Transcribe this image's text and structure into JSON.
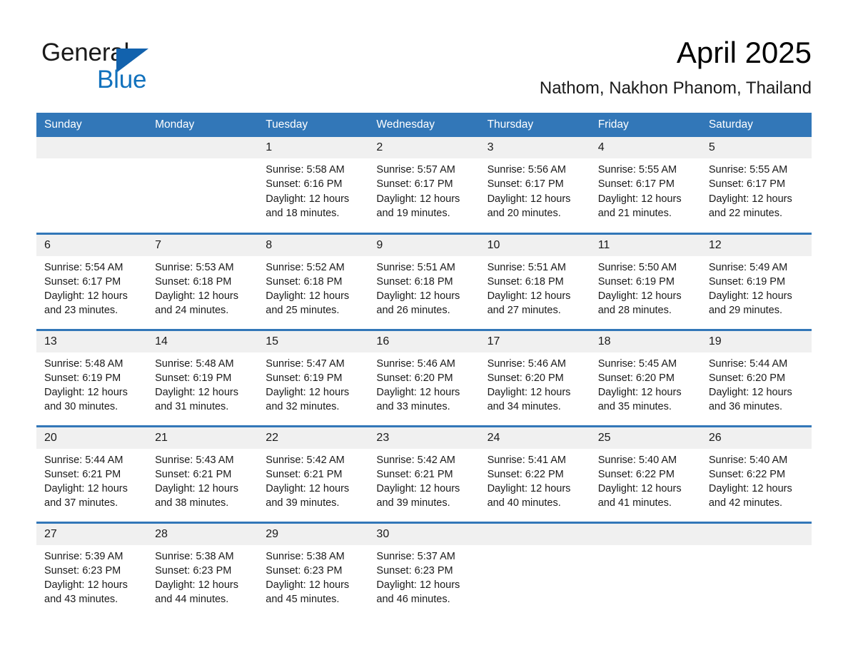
{
  "brand": {
    "logo_text_top": "General",
    "logo_text_bottom": "Blue",
    "accent_blue": "#1272bd"
  },
  "header": {
    "title": "April 2025",
    "location": "Nathom, Nakhon Phanom, Thailand"
  },
  "theme": {
    "header_blue": "#3277b8",
    "daynum_band": "#f0f0f0",
    "text": "#1a1a1a"
  },
  "weekdays": [
    "Sunday",
    "Monday",
    "Tuesday",
    "Wednesday",
    "Thursday",
    "Friday",
    "Saturday"
  ],
  "weeks": [
    [
      {
        "day": "",
        "empty": true
      },
      {
        "day": "",
        "empty": true
      },
      {
        "day": "1",
        "sunrise": "Sunrise: 5:58 AM",
        "sunset": "Sunset: 6:16 PM",
        "daylight": "Daylight: 12 hours and 18 minutes."
      },
      {
        "day": "2",
        "sunrise": "Sunrise: 5:57 AM",
        "sunset": "Sunset: 6:17 PM",
        "daylight": "Daylight: 12 hours and 19 minutes."
      },
      {
        "day": "3",
        "sunrise": "Sunrise: 5:56 AM",
        "sunset": "Sunset: 6:17 PM",
        "daylight": "Daylight: 12 hours and 20 minutes."
      },
      {
        "day": "4",
        "sunrise": "Sunrise: 5:55 AM",
        "sunset": "Sunset: 6:17 PM",
        "daylight": "Daylight: 12 hours and 21 minutes."
      },
      {
        "day": "5",
        "sunrise": "Sunrise: 5:55 AM",
        "sunset": "Sunset: 6:17 PM",
        "daylight": "Daylight: 12 hours and 22 minutes."
      }
    ],
    [
      {
        "day": "6",
        "sunrise": "Sunrise: 5:54 AM",
        "sunset": "Sunset: 6:17 PM",
        "daylight": "Daylight: 12 hours and 23 minutes."
      },
      {
        "day": "7",
        "sunrise": "Sunrise: 5:53 AM",
        "sunset": "Sunset: 6:18 PM",
        "daylight": "Daylight: 12 hours and 24 minutes."
      },
      {
        "day": "8",
        "sunrise": "Sunrise: 5:52 AM",
        "sunset": "Sunset: 6:18 PM",
        "daylight": "Daylight: 12 hours and 25 minutes."
      },
      {
        "day": "9",
        "sunrise": "Sunrise: 5:51 AM",
        "sunset": "Sunset: 6:18 PM",
        "daylight": "Daylight: 12 hours and 26 minutes."
      },
      {
        "day": "10",
        "sunrise": "Sunrise: 5:51 AM",
        "sunset": "Sunset: 6:18 PM",
        "daylight": "Daylight: 12 hours and 27 minutes."
      },
      {
        "day": "11",
        "sunrise": "Sunrise: 5:50 AM",
        "sunset": "Sunset: 6:19 PM",
        "daylight": "Daylight: 12 hours and 28 minutes."
      },
      {
        "day": "12",
        "sunrise": "Sunrise: 5:49 AM",
        "sunset": "Sunset: 6:19 PM",
        "daylight": "Daylight: 12 hours and 29 minutes."
      }
    ],
    [
      {
        "day": "13",
        "sunrise": "Sunrise: 5:48 AM",
        "sunset": "Sunset: 6:19 PM",
        "daylight": "Daylight: 12 hours and 30 minutes."
      },
      {
        "day": "14",
        "sunrise": "Sunrise: 5:48 AM",
        "sunset": "Sunset: 6:19 PM",
        "daylight": "Daylight: 12 hours and 31 minutes."
      },
      {
        "day": "15",
        "sunrise": "Sunrise: 5:47 AM",
        "sunset": "Sunset: 6:19 PM",
        "daylight": "Daylight: 12 hours and 32 minutes."
      },
      {
        "day": "16",
        "sunrise": "Sunrise: 5:46 AM",
        "sunset": "Sunset: 6:20 PM",
        "daylight": "Daylight: 12 hours and 33 minutes."
      },
      {
        "day": "17",
        "sunrise": "Sunrise: 5:46 AM",
        "sunset": "Sunset: 6:20 PM",
        "daylight": "Daylight: 12 hours and 34 minutes."
      },
      {
        "day": "18",
        "sunrise": "Sunrise: 5:45 AM",
        "sunset": "Sunset: 6:20 PM",
        "daylight": "Daylight: 12 hours and 35 minutes."
      },
      {
        "day": "19",
        "sunrise": "Sunrise: 5:44 AM",
        "sunset": "Sunset: 6:20 PM",
        "daylight": "Daylight: 12 hours and 36 minutes."
      }
    ],
    [
      {
        "day": "20",
        "sunrise": "Sunrise: 5:44 AM",
        "sunset": "Sunset: 6:21 PM",
        "daylight": "Daylight: 12 hours and 37 minutes."
      },
      {
        "day": "21",
        "sunrise": "Sunrise: 5:43 AM",
        "sunset": "Sunset: 6:21 PM",
        "daylight": "Daylight: 12 hours and 38 minutes."
      },
      {
        "day": "22",
        "sunrise": "Sunrise: 5:42 AM",
        "sunset": "Sunset: 6:21 PM",
        "daylight": "Daylight: 12 hours and 39 minutes."
      },
      {
        "day": "23",
        "sunrise": "Sunrise: 5:42 AM",
        "sunset": "Sunset: 6:21 PM",
        "daylight": "Daylight: 12 hours and 39 minutes."
      },
      {
        "day": "24",
        "sunrise": "Sunrise: 5:41 AM",
        "sunset": "Sunset: 6:22 PM",
        "daylight": "Daylight: 12 hours and 40 minutes."
      },
      {
        "day": "25",
        "sunrise": "Sunrise: 5:40 AM",
        "sunset": "Sunset: 6:22 PM",
        "daylight": "Daylight: 12 hours and 41 minutes."
      },
      {
        "day": "26",
        "sunrise": "Sunrise: 5:40 AM",
        "sunset": "Sunset: 6:22 PM",
        "daylight": "Daylight: 12 hours and 42 minutes."
      }
    ],
    [
      {
        "day": "27",
        "sunrise": "Sunrise: 5:39 AM",
        "sunset": "Sunset: 6:23 PM",
        "daylight": "Daylight: 12 hours and 43 minutes."
      },
      {
        "day": "28",
        "sunrise": "Sunrise: 5:38 AM",
        "sunset": "Sunset: 6:23 PM",
        "daylight": "Daylight: 12 hours and 44 minutes."
      },
      {
        "day": "29",
        "sunrise": "Sunrise: 5:38 AM",
        "sunset": "Sunset: 6:23 PM",
        "daylight": "Daylight: 12 hours and 45 minutes."
      },
      {
        "day": "30",
        "sunrise": "Sunrise: 5:37 AM",
        "sunset": "Sunset: 6:23 PM",
        "daylight": "Daylight: 12 hours and 46 minutes."
      },
      {
        "day": "",
        "empty": true
      },
      {
        "day": "",
        "empty": true
      },
      {
        "day": "",
        "empty": true
      }
    ]
  ]
}
